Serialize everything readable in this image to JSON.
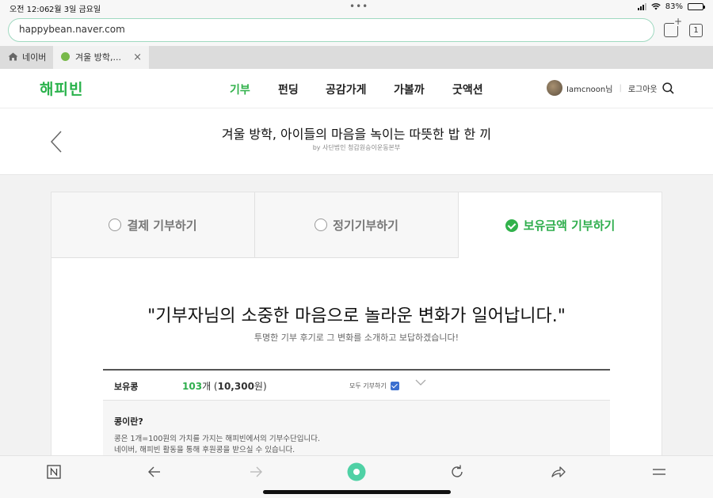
{
  "status_bar": {
    "time": "오전 12:06",
    "date": "2월 3일 금요일",
    "battery": "83%",
    "battery_level": 0.83
  },
  "browser": {
    "url": "happybean.naver.com",
    "tab_count": "1",
    "tabs": [
      {
        "label": "네이버",
        "icon": "home-icon"
      },
      {
        "label": "겨울 방학,...",
        "icon": "favicon",
        "close": "×"
      }
    ]
  },
  "site": {
    "logo": "해피빈",
    "nav": [
      "기부",
      "펀딩",
      "공감가게",
      "가볼까",
      "굿액션"
    ],
    "active_nav": "기부",
    "user_name": "Iamcnoon님",
    "logout": "로그아웃",
    "brand_color": "#31b24b"
  },
  "article": {
    "title": "겨울 방학, 아이들의 마음을 녹이는 따뜻한 밥 한 끼",
    "byline": "by 사단법인 청갑원승이운동본부"
  },
  "donation": {
    "tabs": [
      {
        "label": "결제 기부하기",
        "selected": false
      },
      {
        "label": "정기기부하기",
        "selected": false
      },
      {
        "label": "보유금액 기부하기",
        "selected": true
      }
    ],
    "quote": "\"기부자님의 소중한 마음으로 놀라운 변화가 일어납니다.\"",
    "subquote": "투명한 기부 후기로 그 변화를 소개하고 보답하겠습니다!",
    "bean_label": "보유콩",
    "bean_count": "103",
    "bean_unit": "개 (",
    "bean_won": "10,300",
    "bean_won_unit": "원)",
    "all_donate": "모두 기부하기",
    "all_donate_checked": true,
    "info_title": "콩이란?",
    "info_lines": [
      "콩은 1개=100원의 가치를 가지는 해피빈에서의 기부수단입니다.",
      "네이버, 해피빈 활동을 통해 후원콩을 받으실 수 있습니다."
    ]
  },
  "toolbar": {
    "items": [
      "naver-n-icon",
      "back-arrow-icon",
      "forward-arrow-icon",
      "green-dot-icon",
      "reload-icon",
      "share-icon",
      "menu-icon"
    ]
  }
}
